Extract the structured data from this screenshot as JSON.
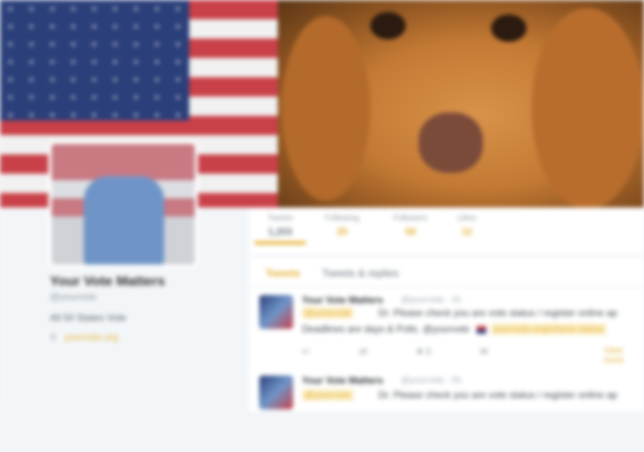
{
  "profile": {
    "name": "Your Vote Matters",
    "handle": "@yourvote",
    "location": "All 50 States Vote",
    "link": "yourvote.org",
    "link_icon": "link-icon"
  },
  "nav": {
    "items": [
      {
        "label": "Tweets",
        "count": "1,203"
      },
      {
        "label": "Following",
        "count": "25"
      },
      {
        "label": "Followers",
        "count": "58"
      },
      {
        "label": "Likes",
        "count": "12"
      }
    ]
  },
  "tabs": {
    "tweets": "Tweets",
    "replies": "Tweets & replies"
  },
  "tweets": [
    {
      "name": "Your Vote Matters",
      "handle": "@yourvote · 2h",
      "mention": "@yourvote",
      "text": "Dr. Please check you are vote status / register online ap",
      "text2": "Deadlines are days & Polls. @yourvote",
      "link": "yourvote.org/check-status",
      "actions": [
        "↩",
        "⇄",
        "♥ 3",
        "✉"
      ],
      "more": "View more"
    },
    {
      "name": "Your Vote Matters",
      "handle": "@yourvote · 5h",
      "mention": "@yourvote",
      "text": "Dr. Please check you are vote status / register online ap",
      "text2": "",
      "link": "",
      "actions": [],
      "more": ""
    }
  ],
  "colors": {
    "accent": "#e5b032",
    "background": "#f3f6f8"
  }
}
